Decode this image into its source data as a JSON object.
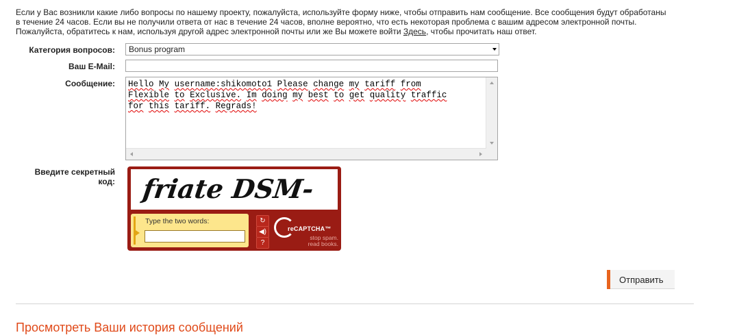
{
  "intro": {
    "line1": "Если у Вас возникли какие либо вопросы по нашему проекту, пожалуйста, используйте форму ниже, чтобы отправить нам сообщение. Все сообщения будут обработаны",
    "line2": "в течение 24 часов. Если вы не получили ответа от нас в течение 24 часов, вполне вероятно, что есть некоторая проблема с вашим адресом электронной почты.",
    "line3_pre": "Пожалуйста, обратитесь к нам, используя другой адрес электронной почты или же Вы можете войти ",
    "line3_link": "Здесь",
    "line3_post": ", чтобы прочитать наш ответ."
  },
  "form": {
    "category_label": "Категория вопросов:",
    "category_value": "Bonus program",
    "email_label": "Ваш E-Mail:",
    "email_value": "",
    "message_label": "Сообщение:",
    "message_words": [
      "Hello",
      " ",
      "My",
      " ",
      "username:shikomoto1",
      " ",
      "Please",
      " ",
      "change",
      " ",
      "my",
      " ",
      "tariff",
      " ",
      "from",
      "\n",
      "Flexible",
      " ",
      "to",
      " ",
      "Exclusive.",
      " ",
      "Im",
      " ",
      "doing",
      " ",
      "my",
      " ",
      "best",
      " ",
      "to",
      " ",
      "get",
      " ",
      "quality",
      " ",
      "traffic",
      "\n",
      "for",
      " ",
      "this",
      " ",
      "tariff.",
      " ",
      "Regrads!"
    ],
    "captcha_label_1": "Введите секретный",
    "captcha_label_2": "код:"
  },
  "captcha": {
    "words": "friate  DSM-",
    "prompt": "Type the two words:",
    "input_value": "",
    "brand": "reCAPTCHA™",
    "tagline_1": "stop spam.",
    "tagline_2": "read books.",
    "reload_icon": "↻",
    "audio_icon": "◀)",
    "help_icon": "?"
  },
  "submit": {
    "label": "Отправить"
  },
  "history": {
    "title": "Просмотреть Ваши история сообщений"
  }
}
